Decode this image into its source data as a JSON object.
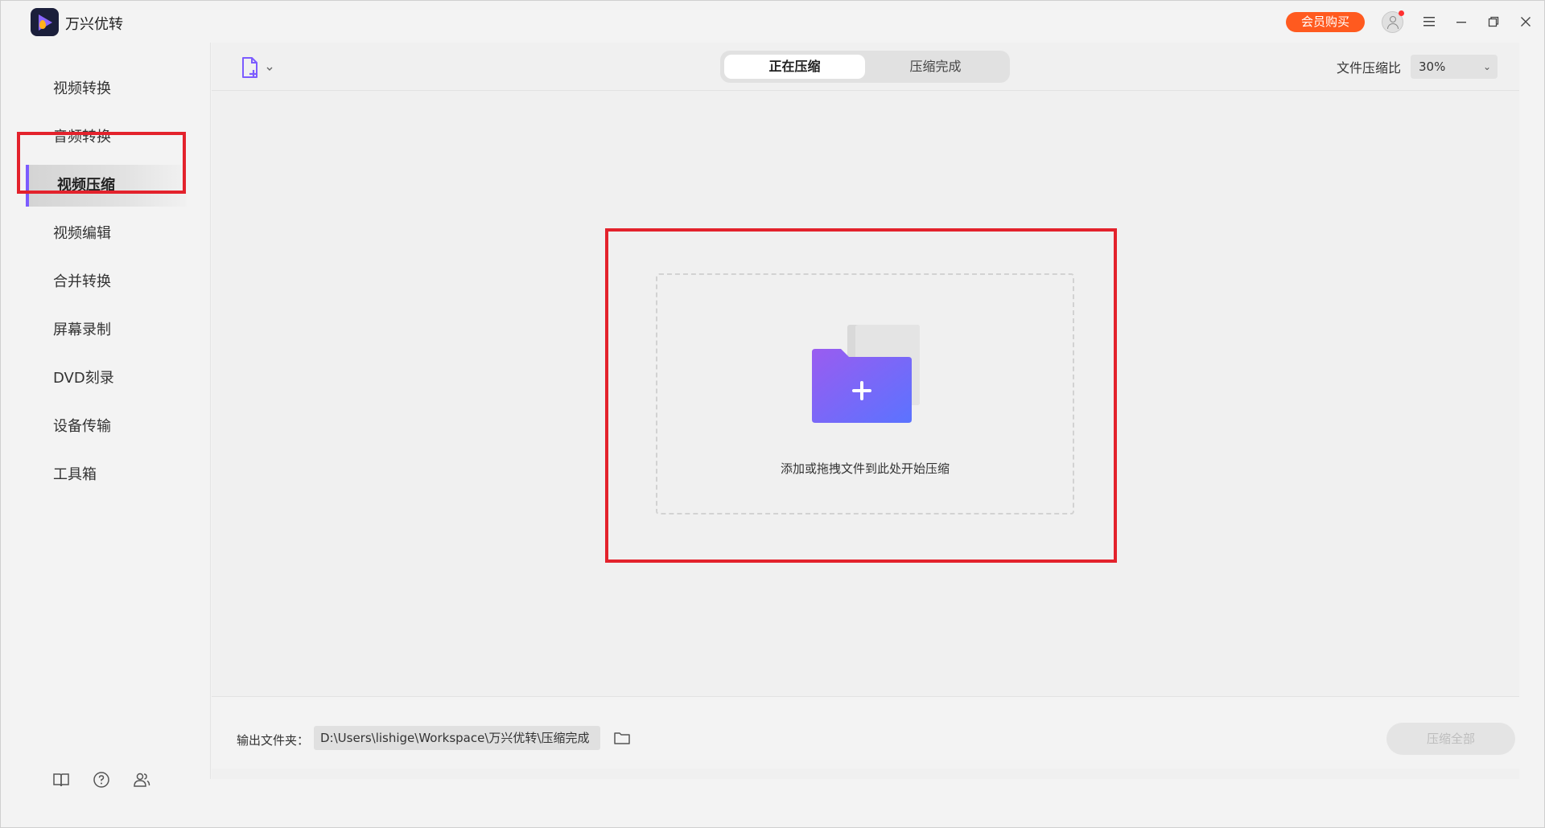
{
  "app": {
    "title": "万兴优转",
    "vip_label": "会员购买"
  },
  "window_controls": {
    "menu_icon": "menu-icon",
    "minimize_icon": "minimize-icon",
    "restore_icon": "restore-icon",
    "close_icon": "close-icon"
  },
  "sidebar": {
    "items": [
      {
        "label": "视频转换"
      },
      {
        "label": "音频转换"
      },
      {
        "label": "视频压缩",
        "active": true
      },
      {
        "label": "视频编辑"
      },
      {
        "label": "合并转换"
      },
      {
        "label": "屏幕录制"
      },
      {
        "label": "DVD刻录"
      },
      {
        "label": "设备传输"
      },
      {
        "label": "工具箱"
      }
    ],
    "footer_icons": [
      "book-icon",
      "help-icon",
      "users-icon"
    ]
  },
  "toolbar": {
    "tabs": [
      {
        "label": "正在压缩",
        "active": true
      },
      {
        "label": "压缩完成"
      }
    ],
    "ratio_label": "文件压缩比",
    "ratio_value": "30%"
  },
  "drop_zone": {
    "text": "添加或拖拽文件到此处开始压缩"
  },
  "bottom": {
    "output_label": "输出文件夹：",
    "output_path": "D:\\Users\\lishige\\Workspace\\万兴优转\\压缩完成",
    "compress_all_label": "压缩全部"
  },
  "colors": {
    "accent": "#7c5cff",
    "vip": "#ff5a1f",
    "highlight": "#e3222c"
  }
}
